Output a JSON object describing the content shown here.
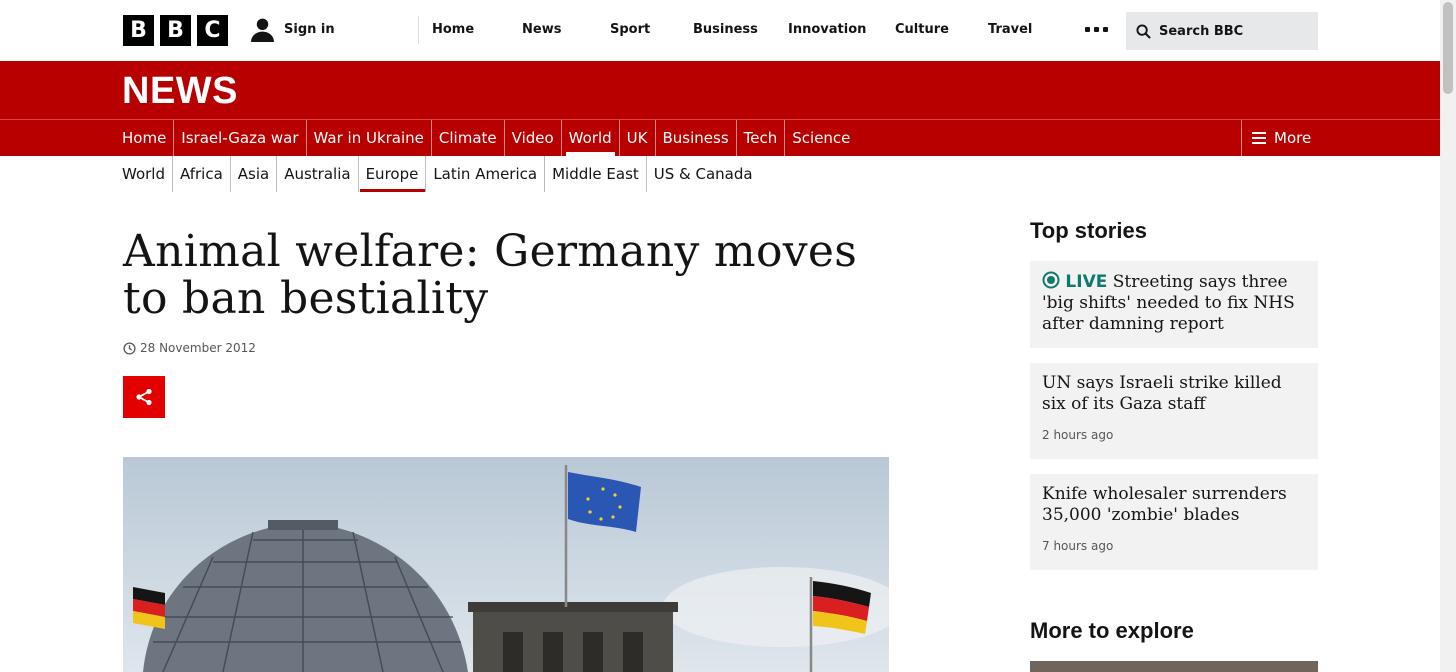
{
  "topbar": {
    "logo_letters": [
      "B",
      "B",
      "C"
    ],
    "signin_label": "Sign in",
    "nav": [
      "Home",
      "News",
      "Sport",
      "Business",
      "Innovation",
      "Culture",
      "Travel"
    ],
    "search_placeholder": "Search BBC"
  },
  "banner": {
    "title": "NEWS"
  },
  "section_nav": {
    "items": [
      "Home",
      "Israel-Gaza war",
      "War in Ukraine",
      "Climate",
      "Video",
      "World",
      "UK",
      "Business",
      "Tech",
      "Science"
    ],
    "active": "World",
    "more_label": "More"
  },
  "sub_nav": {
    "items": [
      "World",
      "Africa",
      "Asia",
      "Australia",
      "Europe",
      "Latin America",
      "Middle East",
      "US & Canada"
    ],
    "active": "Europe"
  },
  "article": {
    "headline": "Animal welfare: Germany moves to ban bestiality",
    "date": "28 November 2012"
  },
  "sidebar": {
    "top_stories_heading": "Top stories",
    "stories": [
      {
        "live_label": "LIVE",
        "title": "Streeting says three 'big shifts' needed to fix NHS after damning report",
        "time": ""
      },
      {
        "live_label": "",
        "title": "UN says Israeli strike killed six of its Gaza staff",
        "time": "2 hours ago"
      },
      {
        "live_label": "",
        "title": "Knife wholesaler surrenders 35,000 'zombie' blades",
        "time": "7 hours ago"
      }
    ],
    "explore_heading": "More to explore"
  },
  "colors": {
    "brand_red": "#b80000",
    "share_red": "#e30000",
    "live_green": "#0f7a6b"
  },
  "icons": {
    "account": "user-icon",
    "search": "search-icon",
    "menu": "hamburger-icon",
    "share": "share-icon",
    "clock": "clock-icon",
    "live": "live-icon"
  }
}
